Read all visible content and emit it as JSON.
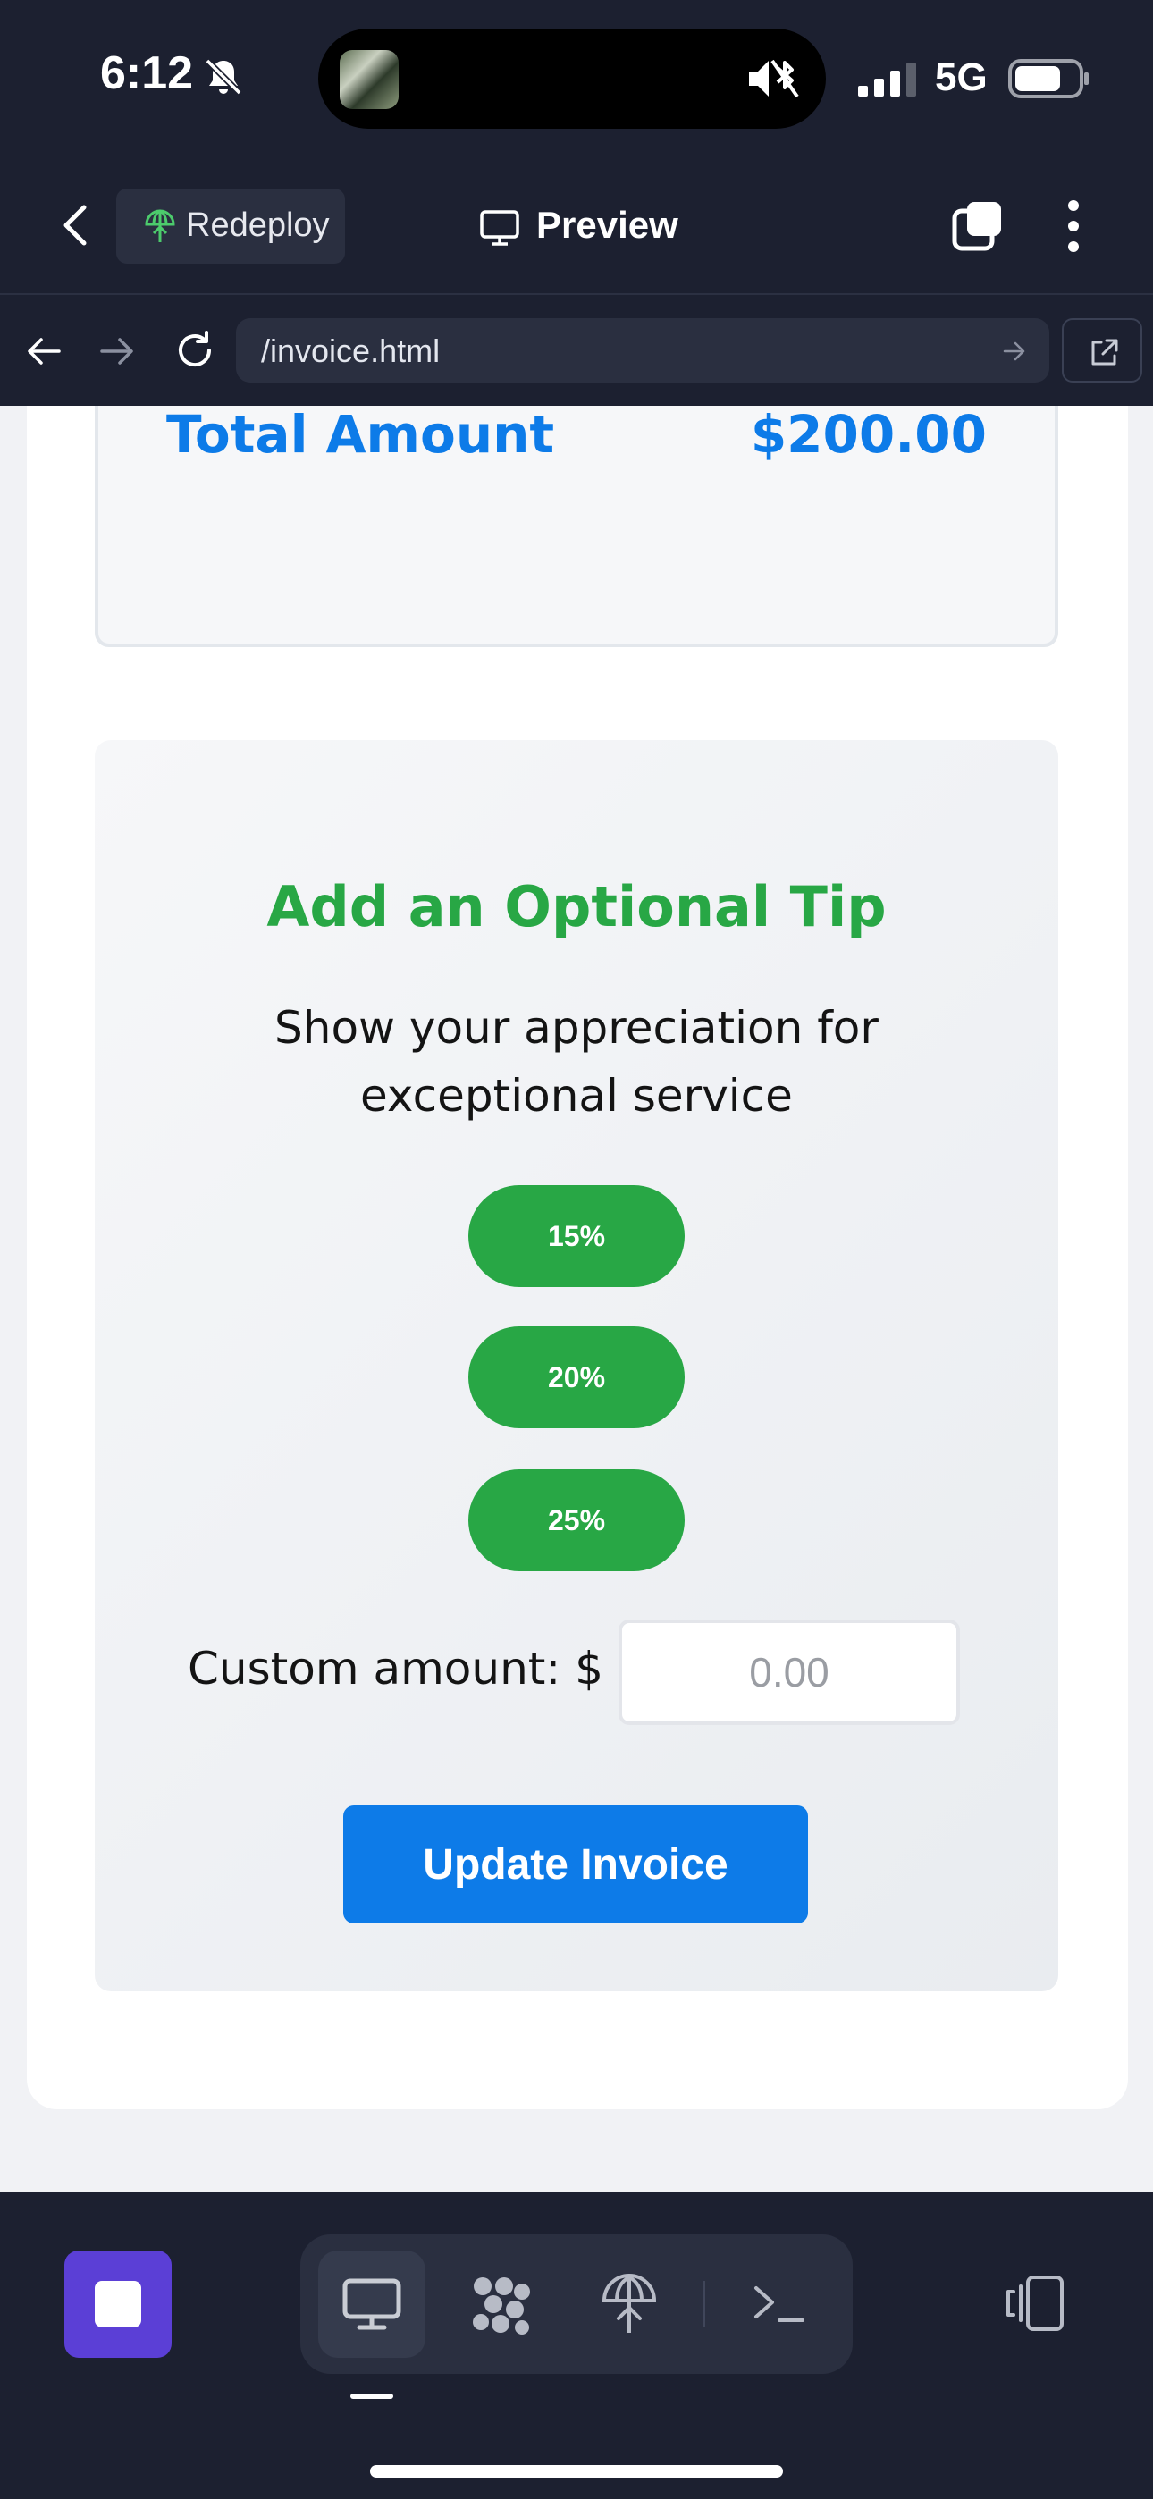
{
  "status_bar": {
    "time": "6:12",
    "network": "5G"
  },
  "header": {
    "redeploy_label": "Redeploy",
    "preview_label": "Preview"
  },
  "url_bar": {
    "url": "/invoice.html"
  },
  "invoice": {
    "total_label": "Total Amount",
    "total_value": "$200.00"
  },
  "tip": {
    "title": "Add an Optional Tip",
    "subtitle": "Show your appreciation for exceptional service",
    "options": [
      "15%",
      "20%",
      "25%"
    ],
    "custom_label": "Custom amount: $",
    "custom_placeholder": "0.00",
    "update_label": "Update Invoice"
  },
  "toolbar": {
    "tools": [
      "monitor-icon",
      "grid-dots-icon",
      "deploy-icon",
      "terminal-icon"
    ],
    "active_tool": "monitor-icon"
  },
  "colors": {
    "chrome_bg": "#1c2030",
    "accent_blue": "#0d7be8",
    "tip_green": "#28a745",
    "stop_purple": "#5b3fd6"
  }
}
